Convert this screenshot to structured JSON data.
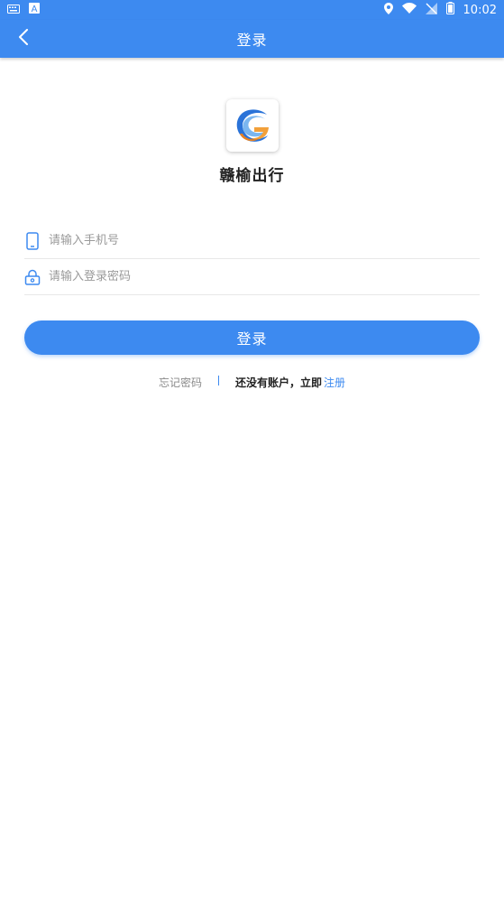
{
  "status_bar": {
    "time": "10:02",
    "icons": [
      "keyboard-icon",
      "a-icon",
      "location-icon",
      "wifi-icon",
      "no-signal-icon",
      "battery-icon"
    ]
  },
  "header": {
    "title": "登录",
    "back_icon": "chevron-left-icon"
  },
  "app": {
    "name": "赣榆出行",
    "logo": "app-logo"
  },
  "form": {
    "phone_placeholder": "请输入手机号",
    "password_placeholder": "请输入登录密码"
  },
  "login_button_label": "登录",
  "links": {
    "forgot_password": "忘记密码",
    "no_account": "还没有账户，立即",
    "register": "注册"
  },
  "colors": {
    "primary": "#3d8af0"
  }
}
